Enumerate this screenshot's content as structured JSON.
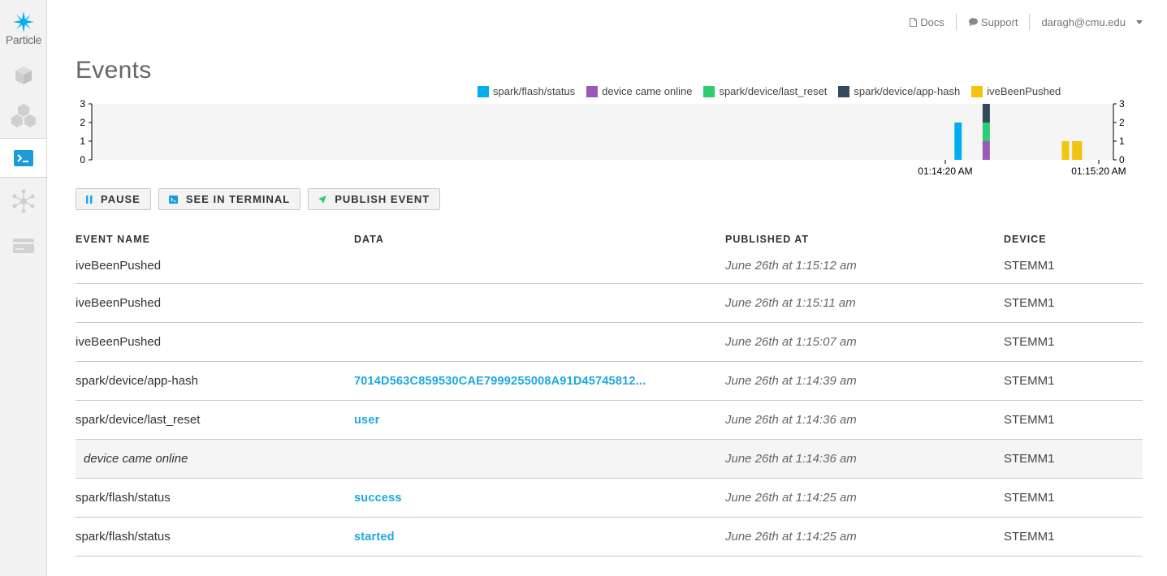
{
  "app": {
    "logo_text": "Particle",
    "accent": "#00aeef"
  },
  "sidebar": {
    "items": [
      {
        "name": "device-icon",
        "active": false
      },
      {
        "name": "products-icon",
        "active": false
      },
      {
        "name": "console-icon",
        "active": true
      },
      {
        "name": "mesh-network-icon",
        "active": false
      },
      {
        "name": "billing-card-icon",
        "active": false
      }
    ]
  },
  "topbar": {
    "docs": "Docs",
    "support": "Support",
    "user": "daragh@cmu.edu"
  },
  "page": {
    "title": "Events"
  },
  "legend": [
    {
      "label": "spark/flash/status",
      "color": "#00aeef"
    },
    {
      "label": "device came online",
      "color": "#9b59b6"
    },
    {
      "label": "spark/device/last_reset",
      "color": "#2ecc71"
    },
    {
      "label": "spark/device/app-hash",
      "color": "#34495e"
    },
    {
      "label": "iveBeenPushed",
      "color": "#f1c40f"
    }
  ],
  "chart_data": {
    "type": "bar",
    "stacked": true,
    "ylim": [
      0,
      3
    ],
    "yticks": [
      "0",
      "1",
      "2",
      "3"
    ],
    "xticks": [
      "01:14:20 AM",
      "01:15:20 AM"
    ],
    "series": [
      {
        "name": "spark/flash/status",
        "color": "#00aeef",
        "points": [
          {
            "x": "01:14:25 AM",
            "y": 2
          }
        ]
      },
      {
        "name": "device came online",
        "color": "#9b59b6",
        "points": [
          {
            "x": "01:14:36 AM",
            "y": 1
          }
        ]
      },
      {
        "name": "spark/device/last_reset",
        "color": "#2ecc71",
        "points": [
          {
            "x": "01:14:36 AM",
            "y": 1
          }
        ]
      },
      {
        "name": "spark/device/app-hash",
        "color": "#34495e",
        "points": [
          {
            "x": "01:14:36 AM",
            "y": 1
          }
        ]
      },
      {
        "name": "iveBeenPushed",
        "color": "#f1c40f",
        "points": [
          {
            "x": "01:15:07 AM",
            "y": 1
          },
          {
            "x": "01:15:11 AM",
            "y": 1
          },
          {
            "x": "01:15:12 AM",
            "y": 1
          }
        ]
      }
    ]
  },
  "buttons": {
    "pause": "PAUSE",
    "terminal": "SEE IN TERMINAL",
    "publish": "PUBLISH EVENT"
  },
  "table": {
    "headers": {
      "name": "EVENT NAME",
      "data": "DATA",
      "published": "PUBLISHED AT",
      "device": "DEVICE"
    },
    "rows": [
      {
        "name": "iveBeenPushed",
        "data": "",
        "time": "June 26th at 1:15:12 am",
        "device": "STEMM1"
      },
      {
        "name": "iveBeenPushed",
        "data": "",
        "time": "June 26th at 1:15:11 am",
        "device": "STEMM1"
      },
      {
        "name": "iveBeenPushed",
        "data": "",
        "time": "June 26th at 1:15:07 am",
        "device": "STEMM1"
      },
      {
        "name": "spark/device/app-hash",
        "data": "7014D563C859530CAE7999255008A91D45745812...",
        "time": "June 26th at 1:14:39 am",
        "device": "STEMM1"
      },
      {
        "name": "spark/device/last_reset",
        "data": "user",
        "time": "June 26th at 1:14:36 am",
        "device": "STEMM1"
      },
      {
        "name": "device came online",
        "data": "",
        "time": "June 26th at 1:14:36 am",
        "device": "STEMM1"
      },
      {
        "name": "spark/flash/status",
        "data": "success",
        "time": "June 26th at 1:14:25 am",
        "device": "STEMM1"
      },
      {
        "name": "spark/flash/status",
        "data": "started",
        "time": "June 26th at 1:14:25 am",
        "device": "STEMM1"
      }
    ]
  }
}
